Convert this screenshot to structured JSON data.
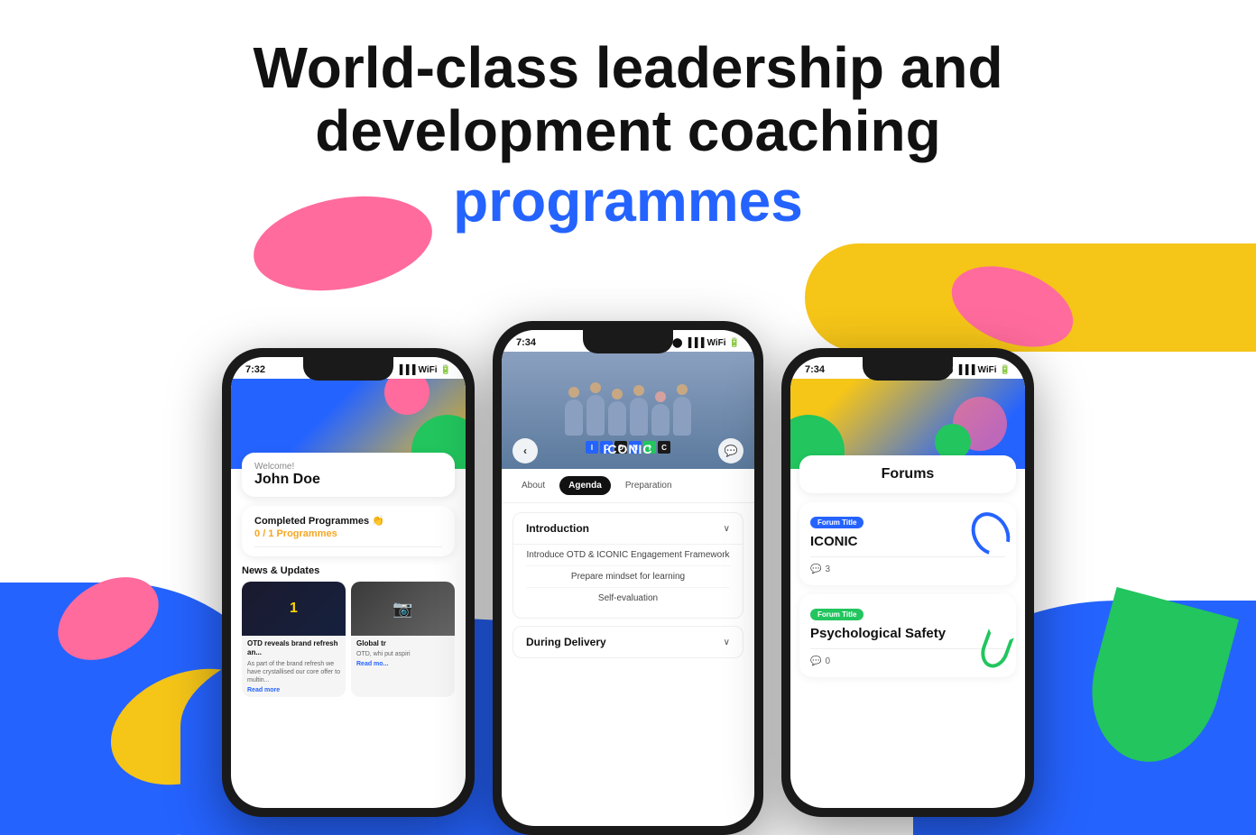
{
  "hero": {
    "line1": "World-class leadership and",
    "line2": "development coaching",
    "line3": "programmes"
  },
  "phone_left": {
    "time": "7:32",
    "welcome_label": "Welcome!",
    "user_name": "John Doe",
    "completed_title": "Completed Programmes 👏",
    "completed_count": "0",
    "completed_total": "/ 1 Programmes",
    "news_section_title": "News & Updates",
    "news_items": [
      {
        "title": "OTD reveals brand refresh an...",
        "description": "As part of the brand refresh we have crystallised our core offer to multin...",
        "read_more": "Read more"
      },
      {
        "title": "Global tr",
        "description": "OTD, whi put aspiri",
        "read_more": "Read more"
      }
    ]
  },
  "phone_center": {
    "time": "7:34",
    "programme_title": "ICONIC",
    "tabs": [
      "About",
      "Agenda",
      "Preparation"
    ],
    "active_tab": "Agenda",
    "sections": [
      {
        "title": "Introduction",
        "expanded": true,
        "items": [
          "Introduce OTD & ICONIC Engagement Framework",
          "Prepare mindset for learning",
          "Self-evaluation"
        ]
      },
      {
        "title": "During Delivery",
        "expanded": false,
        "items": []
      }
    ]
  },
  "phone_right": {
    "time": "7:34",
    "page_title": "Forums",
    "forums": [
      {
        "badge": "Forum Title",
        "badge_color": "blue",
        "title": "ICONIC",
        "comments": "3"
      },
      {
        "badge": "Forum Title",
        "badge_color": "green",
        "title": "Psychological Safety",
        "comments": "0"
      }
    ]
  },
  "icons": {
    "back": "‹",
    "chat": "💬",
    "chevron_down": "∨",
    "comment": "💬",
    "signal": "▐▐▐",
    "wifi": "WiFi",
    "battery": "🔋"
  }
}
